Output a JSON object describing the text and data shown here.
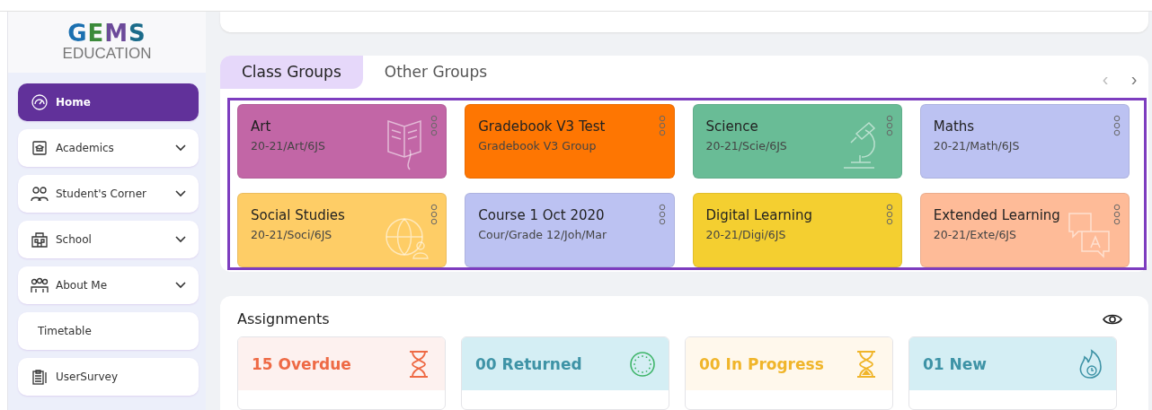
{
  "sidebar": {
    "logo": {
      "mark": "GEMS",
      "text": "EDUCATION"
    },
    "items": [
      {
        "label": "Home",
        "kind": "link",
        "selected": true
      },
      {
        "label": "Academics",
        "kind": "group",
        "selected": false,
        "expanded": false
      },
      {
        "label": "Student's Corner",
        "kind": "group",
        "selected": false,
        "expanded": false
      },
      {
        "label": "School",
        "kind": "group",
        "selected": false,
        "expanded": false
      },
      {
        "label": "About Me",
        "kind": "group",
        "selected": false,
        "expanded": false
      },
      {
        "label": "Timetable",
        "kind": "plain",
        "selected": false
      },
      {
        "label": "UserSurvey",
        "kind": "link",
        "selected": false
      }
    ]
  },
  "groups": {
    "tabs": [
      {
        "label": "Class Groups",
        "selected": true
      },
      {
        "label": "Other Groups",
        "selected": false
      }
    ],
    "nav": [
      "‹",
      "›"
    ],
    "cards": [
      {
        "title": "Art",
        "code": "20-21/Art/6JS",
        "color": "#c266a6"
      },
      {
        "title": "Gradebook V3 Test",
        "code": "Gradebook V3 Group",
        "color": "#fe7602"
      },
      {
        "title": "Science",
        "code": "20-21/Scie/6JS",
        "color": "#69bc96"
      },
      {
        "title": "Maths",
        "code": "20-21/Math/6JS",
        "color": "#bcc2f2"
      },
      {
        "title": "Social Studies",
        "code": "20-21/Soci/6JS",
        "color": "#fecd66"
      },
      {
        "title": "Course 1 Oct 2020",
        "code": "Cour/Grade 12/Joh/Mar",
        "color": "#bcc2f2"
      },
      {
        "title": "Digital Learning",
        "code": "20-21/Digi/6JS",
        "color": "#f4cf30"
      },
      {
        "title": "Extended Learning",
        "code": "20-21/Exte/6JS",
        "color": "#febb98"
      }
    ]
  },
  "assignments": {
    "title": "Assignments",
    "stats": [
      {
        "count": "15",
        "label": "Overdue",
        "color": "#ee6a45"
      },
      {
        "count": "00",
        "label": "Returned",
        "color": "#3e93a6"
      },
      {
        "count": "00",
        "label": "In Progress",
        "color": "#f0b52a"
      },
      {
        "count": "01",
        "label": "New",
        "color": "#3e93a6"
      }
    ]
  }
}
